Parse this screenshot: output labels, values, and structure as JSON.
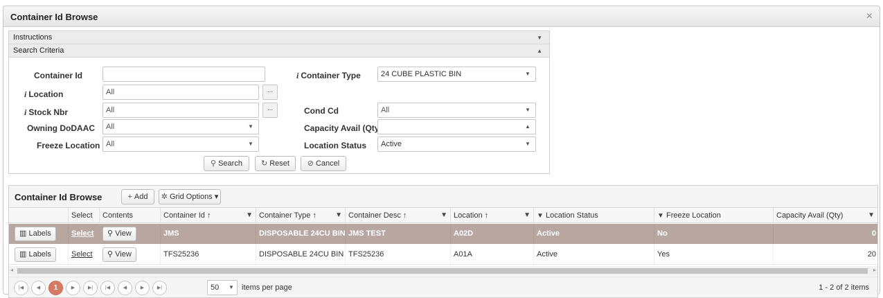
{
  "window": {
    "title": "Container Id Browse",
    "close_glyph": "×"
  },
  "panel": {
    "instructions_label": "Instructions",
    "search_criteria_label": "Search Criteria",
    "info_glyph": "i",
    "fields": {
      "container_id": {
        "label": "Container Id",
        "value": ""
      },
      "location": {
        "label": "Location",
        "value": "All"
      },
      "stock_nbr": {
        "label": "Stock Nbr",
        "value": "All"
      },
      "owning_dodaac": {
        "label": "Owning DoDAAC",
        "value": "All"
      },
      "freeze_location": {
        "label": "Freeze Location",
        "value": "All"
      },
      "container_type": {
        "label": "Container Type",
        "value": "24 CUBE PLASTIC BIN"
      },
      "cond_cd": {
        "label": "Cond Cd",
        "value": "All"
      },
      "capacity_avail": {
        "label": "Capacity Avail (Qty)",
        "value": ""
      },
      "location_status": {
        "label": "Location Status",
        "value": "Active"
      }
    },
    "ellipsis": "...",
    "buttons": {
      "search": "Search",
      "reset": "Reset",
      "cancel": "Cancel"
    }
  },
  "grid": {
    "title": "Container Id Browse",
    "add_label": "Add",
    "grid_options_label": "Grid Options",
    "columns": [
      "Select",
      "Contents",
      "Container Id",
      "Container Type",
      "Container Desc",
      "Location",
      "Location Status",
      "Freeze Location",
      "Capacity Avail (Qty)"
    ],
    "sort_glyph": "↑",
    "row_buttons": {
      "labels": "Labels",
      "select": "Select",
      "view": "View"
    },
    "rows": [
      {
        "container_id": "JMS",
        "container_type": "DISPOSABLE 24CU BIN",
        "container_desc": "JMS TEST",
        "location": "A02D",
        "location_status": "Active",
        "freeze_location": "No",
        "capacity_avail": "0"
      },
      {
        "container_id": "TFS25236",
        "container_type": "DISPOSABLE 24CU BIN",
        "container_desc": "TFS25236",
        "location": "A01A",
        "location_status": "Active",
        "freeze_location": "Yes",
        "capacity_avail": "20"
      }
    ],
    "pager": {
      "current_page": "1",
      "page_size": "50",
      "items_per_page_label": "items per page",
      "summary": "1 - 2 of 2 items"
    }
  },
  "colors": {
    "selected_row": "#b8a7a1",
    "active_page": "#d77a63"
  }
}
